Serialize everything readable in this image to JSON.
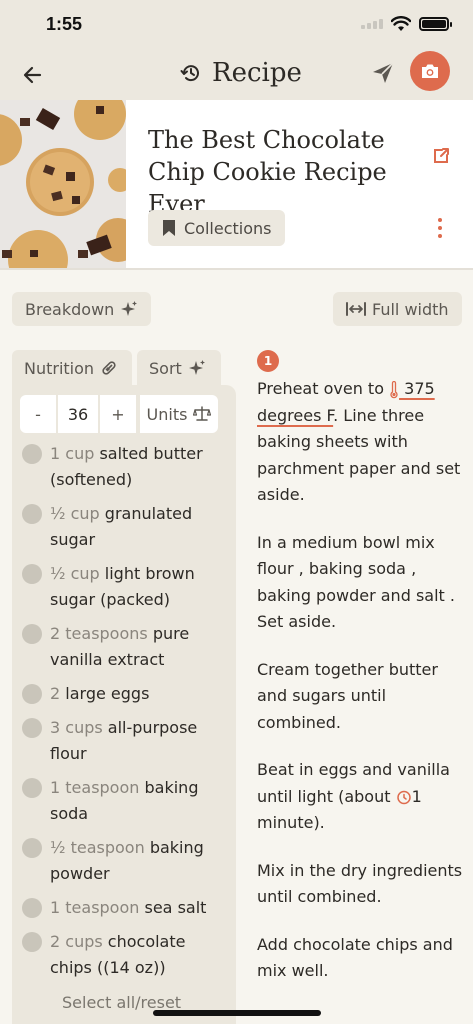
{
  "status_bar": {
    "time": "1:55"
  },
  "nav": {
    "title": "Recipe"
  },
  "recipe": {
    "title": "The Best Chocolate Chip Cookie Recipe Ever",
    "collections_label": "Collections"
  },
  "controls": {
    "breakdown_label": "Breakdown",
    "full_width_label": "Full width"
  },
  "ingredients_panel": {
    "tabs": {
      "nutrition": "Nutrition",
      "sort": "Sort"
    },
    "servings": {
      "minus": "-",
      "value": "36",
      "plus": "+",
      "units_label": "Units"
    },
    "items": [
      {
        "qty": "1 cup",
        "name": "salted butter (softened)"
      },
      {
        "qty": "½ cup",
        "name": "granulated sugar"
      },
      {
        "qty": "½ cup",
        "name": "light brown sugar (packed)"
      },
      {
        "qty": "2 teaspoons",
        "name": "pure vanilla extract"
      },
      {
        "qty": "2",
        "name": "large eggs"
      },
      {
        "qty": "3 cups",
        "name": "all-purpose flour"
      },
      {
        "qty": "1 teaspoon",
        "name": "baking soda"
      },
      {
        "qty": "½ teaspoon",
        "name": "baking powder"
      },
      {
        "qty": "1 teaspoon",
        "name": "sea salt"
      },
      {
        "qty": "2 cups",
        "name": "chocolate chips ((14 oz))"
      }
    ],
    "select_all_label": "Select all/reset"
  },
  "steps": {
    "number": "1",
    "step1": {
      "before": "Preheat oven to ",
      "temp": " 375 degrees F",
      "after": ". Line three baking sheets with parchment paper and set aside."
    },
    "step2": "In a medium bowl mix flour , baking soda , baking powder and salt . Set aside.",
    "step3": "Cream together butter and sugars until combined.",
    "step4": {
      "before": "Beat in eggs and vanilla until light (about ",
      "time": "1 minute",
      "after": ")."
    },
    "step5": "Mix in the dry ingredients until combined.",
    "step6": "Add chocolate chips and mix well."
  },
  "colors": {
    "accent": "#de6b4d",
    "background": "#f7f5ef",
    "panel": "#ebe7dd"
  }
}
